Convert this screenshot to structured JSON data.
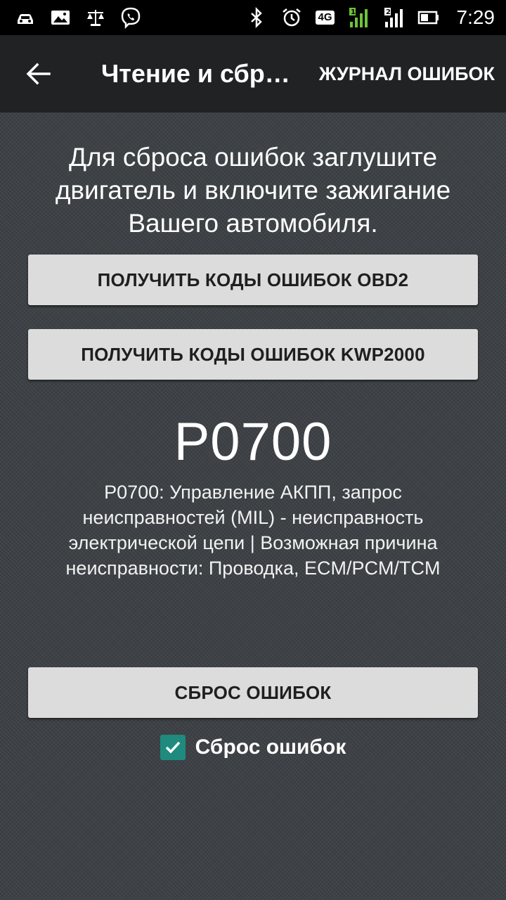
{
  "status_bar": {
    "time": "7:29",
    "network": "4G",
    "icons_left": [
      "car-notification-icon",
      "image-icon",
      "scales-icon",
      "viber-icon"
    ],
    "icons_right": [
      "bluetooth-icon",
      "alarm-icon",
      "network-4g-icon",
      "signal-sim1-icon",
      "signal-sim2-icon",
      "battery-icon"
    ]
  },
  "app_bar": {
    "title": "Чтение и сброс ошибок",
    "action": "ЖУРНАЛ ОШИБОК"
  },
  "main": {
    "instruction": "Для сброса ошибок заглушите двигатель и включите зажигание Вашего автомобиля.",
    "btn_obd2": "ПОЛУЧИТЬ КОДЫ ОШИБОК OBD2",
    "btn_kwp": "ПОЛУЧИТЬ КОДЫ ОШИБОК KWP2000",
    "error_code": "P0700",
    "error_description": "P0700: Управление АКПП, запрос неисправностей (MIL) - неисправность электрической цепи | Возможная причина неисправности: Проводка, ECM/PCM/TCM",
    "btn_reset": "СБРОС ОШИБОК",
    "checkbox_label": "Сброс ошибок",
    "checkbox_checked": true
  },
  "colors": {
    "accent": "#1f8a7e",
    "app_bar": "#212223",
    "background": "#3b4044",
    "button": "#dcdcdc"
  }
}
